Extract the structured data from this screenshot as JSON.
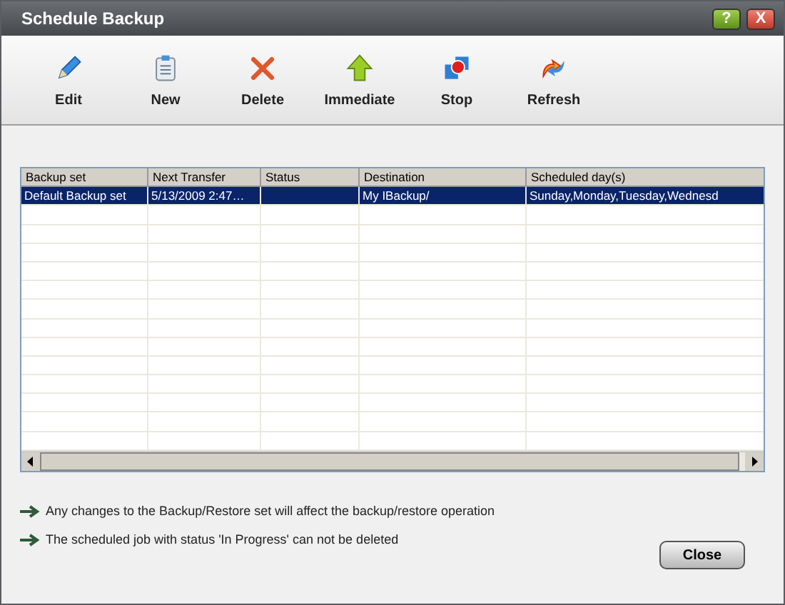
{
  "window": {
    "title": "Schedule Backup",
    "buttons": [
      {
        "kind": "help",
        "label": "?"
      },
      {
        "kind": "close",
        "label": "X"
      }
    ]
  },
  "toolbar": [
    {
      "kind": "edit",
      "label": "Edit"
    },
    {
      "kind": "new",
      "label": "New"
    },
    {
      "kind": "delete",
      "label": "Delete"
    },
    {
      "kind": "immediate",
      "label": "Immediate"
    },
    {
      "kind": "stop",
      "label": "Stop"
    },
    {
      "kind": "refresh",
      "label": "Refresh"
    }
  ],
  "table": {
    "columns": [
      "Backup set",
      "Next Transfer",
      "Status",
      "Destination",
      "Scheduled day(s)"
    ],
    "rows": [
      {
        "selected": true,
        "cells": [
          "Default Backup set",
          "5/13/2009 2:47…",
          "",
          "My IBackup/",
          "Sunday,Monday,Tuesday,Wednesd"
        ]
      }
    ]
  },
  "notes": [
    "Any changes to the Backup/Restore set will affect the backup/restore operation",
    "The scheduled job with status 'In Progress' can not be deleted"
  ],
  "buttons": [
    "Close"
  ]
}
